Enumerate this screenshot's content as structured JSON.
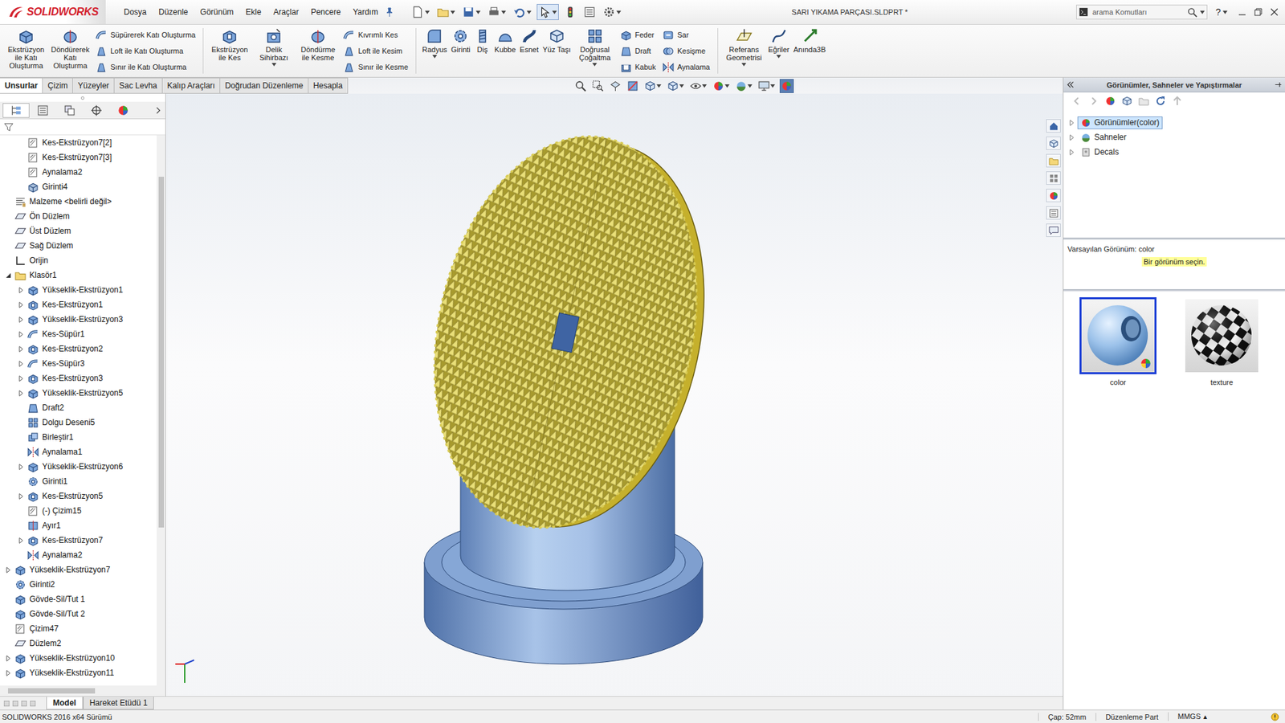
{
  "window": {
    "logo": "SOLIDWORKS",
    "title": "SARI YIKAMA PARÇASI.SLDPRT *"
  },
  "menu": [
    "Dosya",
    "Düzenle",
    "Görünüm",
    "Ekle",
    "Araçlar",
    "Pencere",
    "Yardım"
  ],
  "search": {
    "placeholder": "arama Komutları"
  },
  "help": "?",
  "ribbon": [
    {
      "kind": "large",
      "label": "Ekstrüzyon ile Katı Oluşturma",
      "dropdown": false
    },
    {
      "kind": "large",
      "label": "Döndürerek Katı Oluşturma",
      "dropdown": false
    },
    {
      "kind": "stack",
      "items": [
        "Süpürerek Katı Oluşturma",
        "Loft ile Katı Oluşturma",
        "Sınır ile Katı Oluşturma"
      ]
    },
    {
      "kind": "separator"
    },
    {
      "kind": "large",
      "label": "Ekstrüzyon ile Kes",
      "dropdown": false
    },
    {
      "kind": "large",
      "label": "Delik Sihirbazı",
      "dropdown": true
    },
    {
      "kind": "large",
      "label": "Döndürme ile Kesme",
      "dropdown": false
    },
    {
      "kind": "stack",
      "items": [
        "Kıvrımlı Kes",
        "Loft ile Kesim",
        "Sınır ile Kesme"
      ]
    },
    {
      "kind": "separator"
    },
    {
      "kind": "large",
      "label": "Radyus",
      "dropdown": true
    },
    {
      "kind": "large",
      "label": "Girinti",
      "dropdown": false
    },
    {
      "kind": "large",
      "label": "Diş",
      "dropdown": false
    },
    {
      "kind": "large",
      "label": "Kubbe",
      "dropdown": false
    },
    {
      "kind": "large",
      "label": "Esnet",
      "dropdown": false
    },
    {
      "kind": "large",
      "label": "Yüz Taşı",
      "dropdown": false
    },
    {
      "kind": "large",
      "label": "Doğrusal Çoğaltma",
      "dropdown": true
    },
    {
      "kind": "stack",
      "items": [
        "Feder",
        "Draft",
        "Kabuk"
      ]
    },
    {
      "kind": "stack",
      "items": [
        "Sar",
        "Kesişme",
        "Aynalama"
      ]
    },
    {
      "kind": "separator"
    },
    {
      "kind": "large",
      "label": "Referans Geometrisi",
      "dropdown": true
    },
    {
      "kind": "large",
      "label": "Eğriler",
      "dropdown": true
    },
    {
      "kind": "large",
      "label": "Anında3B",
      "dropdown": false
    }
  ],
  "tabs": [
    {
      "label": "Unsurlar",
      "selected": true
    },
    {
      "label": "Çizim",
      "selected": false
    },
    {
      "label": "Yüzeyler",
      "selected": false
    },
    {
      "label": "Sac Levha",
      "selected": false
    },
    {
      "label": "Kalıp Araçları",
      "selected": false
    },
    {
      "label": "Doğrudan Düzenleme",
      "selected": false
    },
    {
      "label": "Hesapla",
      "selected": false
    }
  ],
  "panel_tabs": [
    {
      "kind": "feature-tree",
      "selected": true
    },
    {
      "kind": "props",
      "selected": false
    },
    {
      "kind": "config",
      "selected": false
    },
    {
      "kind": "crosshair",
      "selected": false
    },
    {
      "kind": "appearance",
      "selected": false
    }
  ],
  "feature_tree": [
    {
      "label": "Kes-Ekstrüzyon7[2]",
      "depth": 2,
      "kind": "sketch",
      "expandable": false,
      "expanded": false
    },
    {
      "label": "Kes-Ekstrüzyon7[3]",
      "depth": 2,
      "kind": "sketch",
      "expandable": false,
      "expanded": false
    },
    {
      "label": "Aynalama2",
      "depth": 2,
      "kind": "sketch",
      "expandable": false,
      "expanded": false
    },
    {
      "label": "Girinti4",
      "depth": 2,
      "kind": "body",
      "expandable": false,
      "expanded": false
    },
    {
      "label": "Malzeme <belirli değil>",
      "depth": 1,
      "kind": "material",
      "expandable": false,
      "expanded": false
    },
    {
      "label": "Ön Düzlem",
      "depth": 1,
      "kind": "plane",
      "expandable": false,
      "expanded": false
    },
    {
      "label": "Üst Düzlem",
      "depth": 1,
      "kind": "plane",
      "expandable": false,
      "expanded": false
    },
    {
      "label": "Sağ Düzlem",
      "depth": 1,
      "kind": "plane",
      "expandable": false,
      "expanded": false
    },
    {
      "label": "Orijin",
      "depth": 1,
      "kind": "origin",
      "expandable": false,
      "expanded": false
    },
    {
      "label": "Klasör1",
      "depth": 1,
      "kind": "folder",
      "expandable": true,
      "expanded": true
    },
    {
      "label": "Yükseklik-Ekstrüzyon1",
      "depth": 2,
      "kind": "extrude",
      "expandable": true,
      "expanded": false
    },
    {
      "label": "Kes-Ekstrüzyon1",
      "depth": 2,
      "kind": "cut",
      "expandable": true,
      "expanded": false
    },
    {
      "label": "Yükseklik-Ekstrüzyon3",
      "depth": 2,
      "kind": "extrude",
      "expandable": true,
      "expanded": false
    },
    {
      "label": "Kes-Süpür1",
      "depth": 2,
      "kind": "sweep",
      "expandable": true,
      "expanded": false
    },
    {
      "label": "Kes-Ekstrüzyon2",
      "depth": 2,
      "kind": "cut",
      "expandable": true,
      "expanded": false
    },
    {
      "label": "Kes-Süpür3",
      "depth": 2,
      "kind": "sweep",
      "expandable": true,
      "expanded": false
    },
    {
      "label": "Kes-Ekstrüzyon3",
      "depth": 2,
      "kind": "cut",
      "expandable": true,
      "expanded": false
    },
    {
      "label": "Yükseklik-Ekstrüzyon5",
      "depth": 2,
      "kind": "extrude",
      "expandable": true,
      "expanded": false
    },
    {
      "label": "Draft2",
      "depth": 2,
      "kind": "draft",
      "expandable": false,
      "expanded": false
    },
    {
      "label": "Dolgu Deseni5",
      "depth": 2,
      "kind": "pattern",
      "expandable": false,
      "expanded": false
    },
    {
      "label": "Birleştir1",
      "depth": 2,
      "kind": "combine",
      "expandable": false,
      "expanded": false
    },
    {
      "label": "Aynalama1",
      "depth": 2,
      "kind": "mirror",
      "expandable": false,
      "expanded": false
    },
    {
      "label": "Yükseklik-Ekstrüzyon6",
      "depth": 2,
      "kind": "extrude",
      "expandable": true,
      "expanded": false
    },
    {
      "label": "Girinti1",
      "depth": 2,
      "kind": "chamfer",
      "expandable": false,
      "expanded": false
    },
    {
      "label": "Kes-Ekstrüzyon5",
      "depth": 2,
      "kind": "cut",
      "expandable": true,
      "expanded": false
    },
    {
      "label": "(-) Çizim15",
      "depth": 2,
      "kind": "sketch",
      "expandable": false,
      "expanded": false
    },
    {
      "label": "Ayır1",
      "depth": 2,
      "kind": "split",
      "expandable": false,
      "expanded": false
    },
    {
      "label": "Kes-Ekstrüzyon7",
      "depth": 2,
      "kind": "cut",
      "expandable": true,
      "expanded": false
    },
    {
      "label": "Aynalama2",
      "depth": 2,
      "kind": "mirror",
      "expandable": false,
      "expanded": false
    },
    {
      "label": "Yükseklik-Ekstrüzyon7",
      "depth": 1,
      "kind": "extrude",
      "expandable": true,
      "expanded": false
    },
    {
      "label": "Girinti2",
      "depth": 1,
      "kind": "chamfer",
      "expandable": false,
      "expanded": false
    },
    {
      "label": "Gövde-Sil/Tut 1",
      "depth": 1,
      "kind": "extrude",
      "expandable": false,
      "expanded": false
    },
    {
      "label": "Gövde-Sil/Tut 2",
      "depth": 1,
      "kind": "extrude",
      "expandable": false,
      "expanded": false
    },
    {
      "label": "Çizim47",
      "depth": 1,
      "kind": "sketch",
      "expandable": false,
      "expanded": false
    },
    {
      "label": "Düzlem2",
      "depth": 1,
      "kind": "plane",
      "expandable": false,
      "expanded": false
    },
    {
      "label": "Yükseklik-Ekstrüzyon10",
      "depth": 1,
      "kind": "extrude",
      "expandable": true,
      "expanded": false
    },
    {
      "label": "Yükseklik-Ekstrüzyon11",
      "depth": 1,
      "kind": "extrude",
      "expandable": true,
      "expanded": false
    }
  ],
  "task_pane": {
    "title": "Görünümler, Sahneler ve Yapıştırmalar",
    "tree": [
      {
        "label": "Görünümler(color)",
        "kind": "appearance",
        "selected": true
      },
      {
        "label": "Sahneler",
        "kind": "scene",
        "selected": false
      },
      {
        "label": "Decals",
        "kind": "decal",
        "selected": false
      }
    ],
    "default_label": "Varsayılan Görünüm: color",
    "hint": "Bir görünüm seçin.",
    "thumbnails": [
      {
        "label": "color",
        "kind": "color",
        "selected": true
      },
      {
        "label": "texture",
        "kind": "texture",
        "selected": false
      }
    ]
  },
  "bottom_tabs": [
    {
      "label": "Model",
      "selected": true
    },
    {
      "label": "Hareket Etüdü 1",
      "selected": false
    }
  ],
  "status_bar": {
    "left": "SOLIDWORKS 2016 x64 Sürümü",
    "fields": [
      "Çap: 52mm",
      "Düzenleme Part",
      "MMGS"
    ],
    "units_caret": "▴"
  }
}
